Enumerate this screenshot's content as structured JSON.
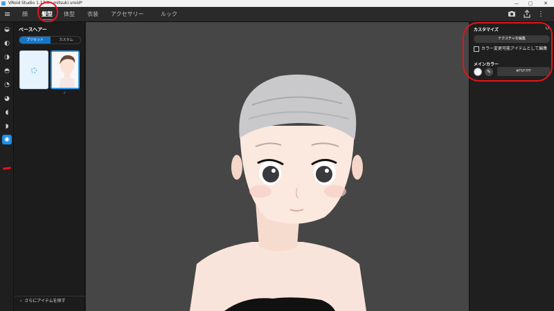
{
  "window": {
    "title": "VRoid Studio 1.17.0 - mitsuki.vroid*",
    "controls": [
      "—",
      "▢",
      "✕"
    ]
  },
  "topnav": {
    "menu_icon": "hamburger-icon",
    "tabs": [
      {
        "label": "顔",
        "active": false
      },
      {
        "label": "髪型",
        "active": true
      },
      {
        "label": "体型",
        "active": false
      },
      {
        "label": "衣装",
        "active": false
      },
      {
        "label": "アクセサリー",
        "active": false
      },
      {
        "label": "ルック",
        "active": false
      }
    ],
    "actions": [
      "camera-icon",
      "export-icon",
      "more-vertical-icon"
    ]
  },
  "left_rail": {
    "items": [
      "head-icon",
      "hair-front-icon",
      "hair-side-icon",
      "hair-back-icon",
      "hair-accent-icon",
      "hair-ahoge-icon",
      "hair-tail-icon",
      "hair-extra-icon",
      "base-hair-icon"
    ],
    "active_index": 8
  },
  "panel": {
    "title": "ベースヘアー",
    "segments": [
      {
        "label": "プリセット",
        "active": true
      },
      {
        "label": "カスタム",
        "active": false
      }
    ],
    "more_items": "さらにアイテムを探す"
  },
  "right_panel": {
    "title": "カスタマイズ",
    "edit_texture": "テクスチャを編集",
    "color_change_item": "カラー変更可能アイテムとして編集",
    "main_color_label": "メインカラー",
    "main_color_hex": "#F5F7FF"
  },
  "colors": {
    "accent": "#1a8fe8",
    "annotation": "#e8121b",
    "hair": "#c9c9cc",
    "skin": "#f8e2d6"
  }
}
